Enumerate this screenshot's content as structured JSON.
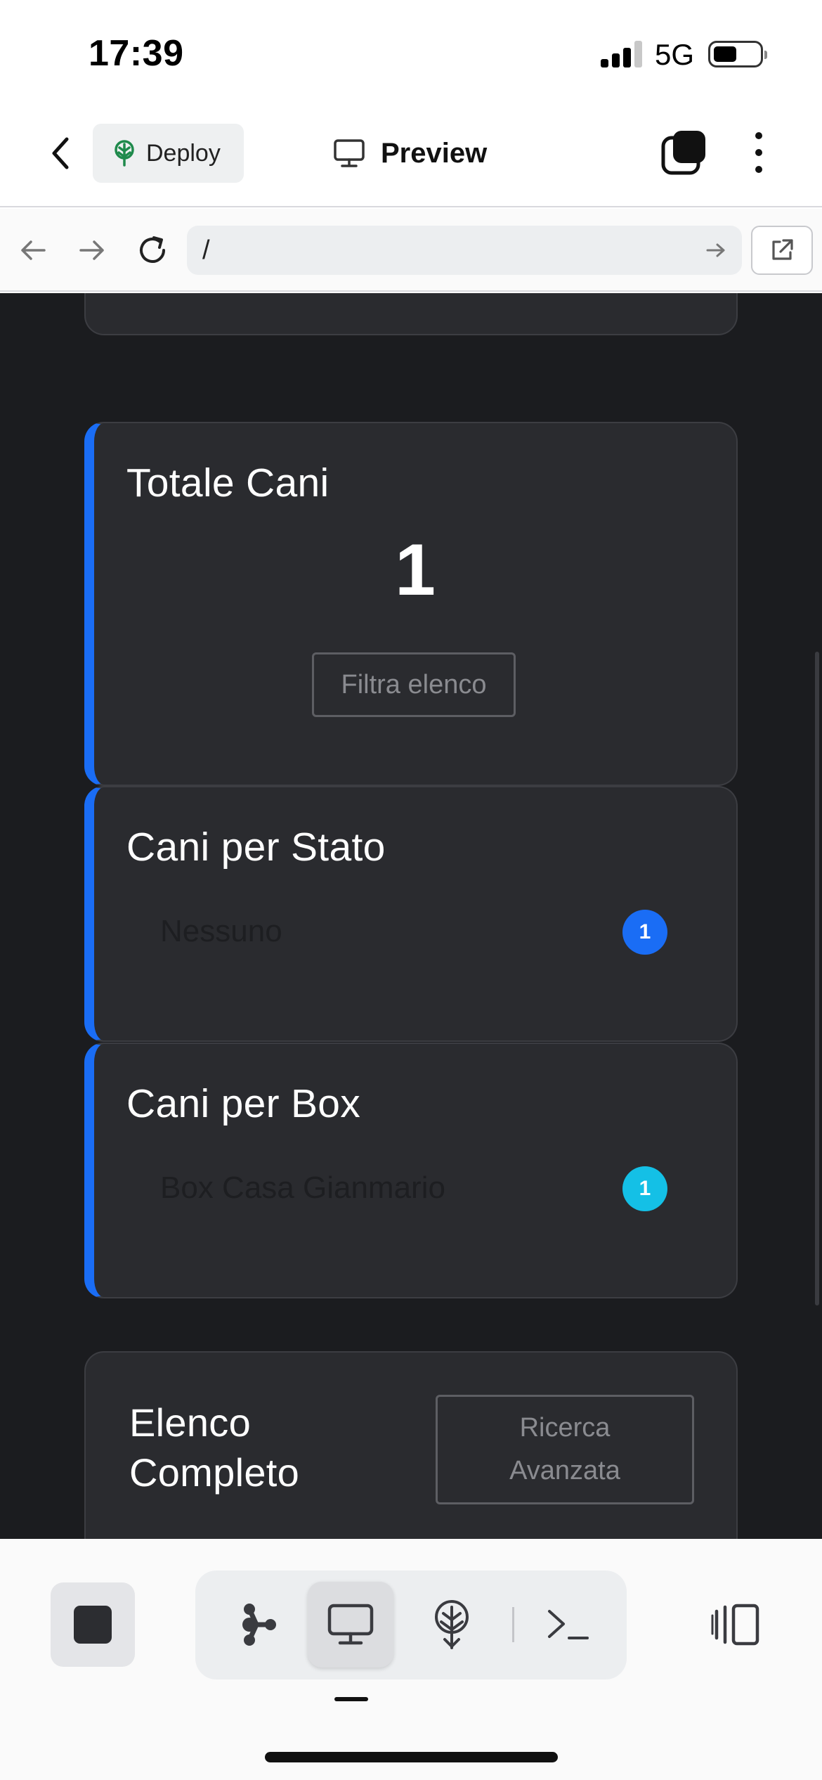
{
  "status_bar": {
    "time": "17:39",
    "network": "5G"
  },
  "header": {
    "deploy_label": "Deploy",
    "title": "Preview"
  },
  "url_bar": {
    "value": "/"
  },
  "cards": {
    "totale": {
      "title": "Totale Cani",
      "value": "1",
      "button": "Filtra elenco"
    },
    "stato": {
      "title": "Cani per Stato",
      "row_label": "Nessuno",
      "count": "1",
      "badge_color": "#1a6df5"
    },
    "box": {
      "title": "Cani per Box",
      "row_label": "Box Casa Gianmario",
      "count": "1",
      "badge_color": "#14c0e6"
    },
    "elenco": {
      "title": "Elenco Completo",
      "button": "Ricerca Avanzata"
    }
  },
  "colors": {
    "accent": "#1a6df5",
    "content_bg": "#1b1c1f",
    "card_bg": "#2a2b2f"
  },
  "icons": {
    "back": "chevron-left-icon",
    "deploy": "deploy-tree-icon",
    "preview": "monitor-icon",
    "tabs": "tabs-icon",
    "more": "more-vertical-icon",
    "nav_back": "arrow-left-icon",
    "nav_forward": "arrow-right-icon",
    "reload": "reload-icon",
    "open_external": "external-link-icon",
    "stop": "stop-icon",
    "graph": "graph-icon",
    "terminal": "terminal-icon",
    "panel": "panel-icon"
  }
}
